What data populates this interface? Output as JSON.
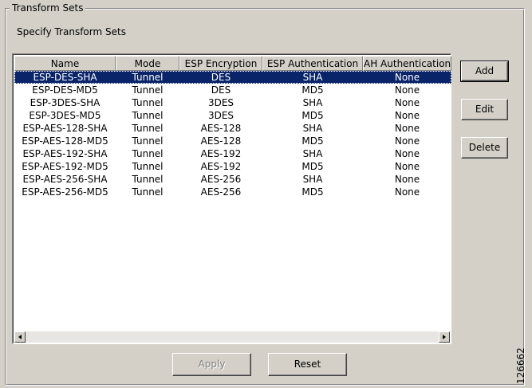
{
  "group": {
    "title": "Transform Sets"
  },
  "subtitle": "Specify Transform Sets",
  "table": {
    "columns": [
      "Name",
      "Mode",
      "ESP Encryption",
      "ESP Authentication",
      "AH Authentication"
    ],
    "selected_index": 0,
    "rows": [
      [
        "ESP-DES-SHA",
        "Tunnel",
        "DES",
        "SHA",
        "None"
      ],
      [
        "ESP-DES-MD5",
        "Tunnel",
        "DES",
        "MD5",
        "None"
      ],
      [
        "ESP-3DES-SHA",
        "Tunnel",
        "3DES",
        "SHA",
        "None"
      ],
      [
        "ESP-3DES-MD5",
        "Tunnel",
        "3DES",
        "MD5",
        "None"
      ],
      [
        "ESP-AES-128-SHA",
        "Tunnel",
        "AES-128",
        "SHA",
        "None"
      ],
      [
        "ESP-AES-128-MD5",
        "Tunnel",
        "AES-128",
        "MD5",
        "None"
      ],
      [
        "ESP-AES-192-SHA",
        "Tunnel",
        "AES-192",
        "SHA",
        "None"
      ],
      [
        "ESP-AES-192-MD5",
        "Tunnel",
        "AES-192",
        "MD5",
        "None"
      ],
      [
        "ESP-AES-256-SHA",
        "Tunnel",
        "AES-256",
        "SHA",
        "None"
      ],
      [
        "ESP-AES-256-MD5",
        "Tunnel",
        "AES-256",
        "MD5",
        "None"
      ]
    ]
  },
  "buttons": {
    "add": "Add",
    "edit": "Edit",
    "delete": "Delete",
    "apply": "Apply",
    "reset": "Reset"
  },
  "scrollbar": {
    "left_icon": "arrow-left-icon",
    "right_icon": "arrow-right-icon"
  },
  "figure_id": "126662"
}
